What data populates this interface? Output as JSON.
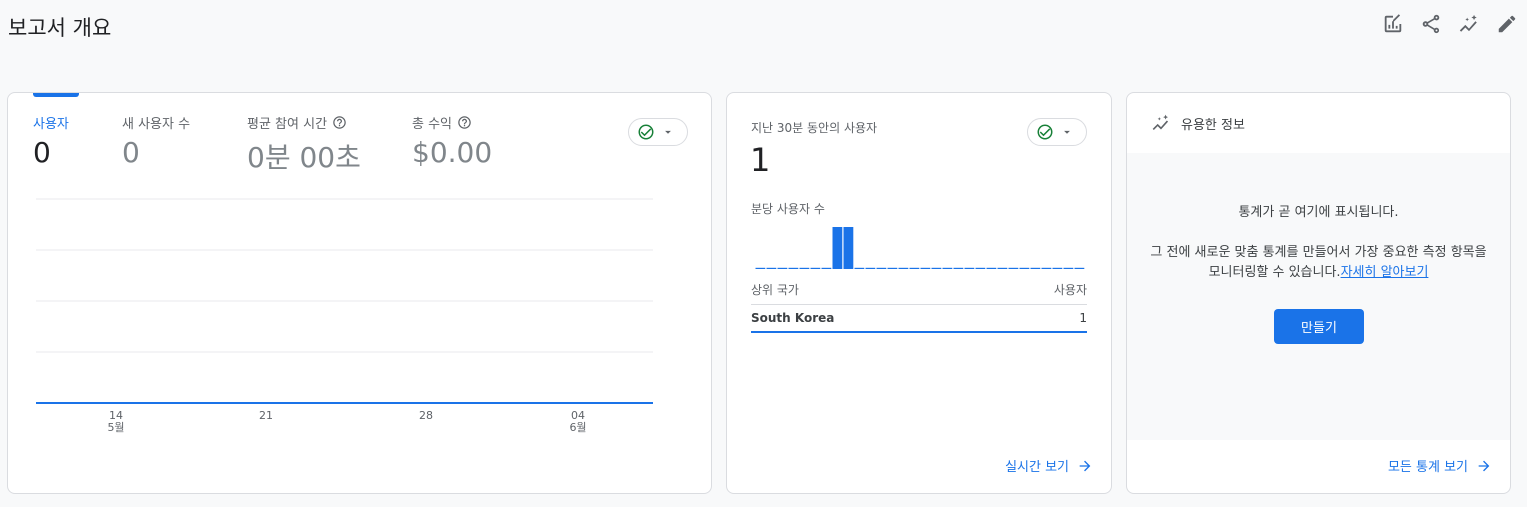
{
  "page": {
    "title": "보고서 개요"
  },
  "toolbar": {
    "icons": [
      "edit-report-icon",
      "share-icon",
      "insights-icon",
      "pencil-icon"
    ]
  },
  "main_card": {
    "metrics": [
      {
        "label": "사용자",
        "value": "0",
        "active": true,
        "help": false
      },
      {
        "label": "새 사용자 수",
        "value": "0",
        "active": false,
        "help": false
      },
      {
        "label": "평균 참여 시간",
        "value": "0분 00초",
        "active": false,
        "help": true
      },
      {
        "label": "총 수익",
        "value": "$0.00",
        "active": false,
        "help": true
      }
    ],
    "chart_data": {
      "type": "line",
      "x_ticks": [
        {
          "day": "14",
          "month": "5월"
        },
        {
          "day": "21",
          "month": ""
        },
        {
          "day": "28",
          "month": ""
        },
        {
          "day": "04",
          "month": "6월"
        }
      ],
      "series": [
        {
          "values": [
            0,
            0,
            0,
            0
          ]
        }
      ],
      "ylim": [
        0,
        4
      ],
      "grid": true,
      "color": "#1a73e8"
    }
  },
  "realtime_card": {
    "title": "지난 30분 동안의 사용자",
    "value": "1",
    "subtitle": "분당 사용자 수",
    "chart_data": {
      "type": "bar",
      "values": [
        0,
        0,
        0,
        0,
        0,
        0,
        0,
        1,
        1,
        0,
        0,
        0,
        0,
        0,
        0,
        0,
        0,
        0,
        0,
        0,
        0,
        0,
        0,
        0,
        0,
        0,
        0,
        0,
        0,
        0
      ],
      "color": "#1a73e8"
    },
    "table": {
      "col_left": "상위 국가",
      "col_right": "사용자",
      "rows": [
        {
          "country": "South Korea",
          "users": "1"
        }
      ]
    },
    "link": "실시간 보기"
  },
  "insights_card": {
    "title": "유용한 정보",
    "line1": "통계가 곧 여기에 표시됩니다.",
    "para": "그 전에 새로운 맞춤 통계를 만들어서 가장 중요한 측정 항목을 모니터링할 수 있습니다.",
    "learn_more": "자세히 알아보기",
    "create_button": "만들기",
    "link": "모든 통계 보기"
  },
  "colors": {
    "accent": "#1a73e8",
    "check": "#188038",
    "border": "#dadce0"
  }
}
